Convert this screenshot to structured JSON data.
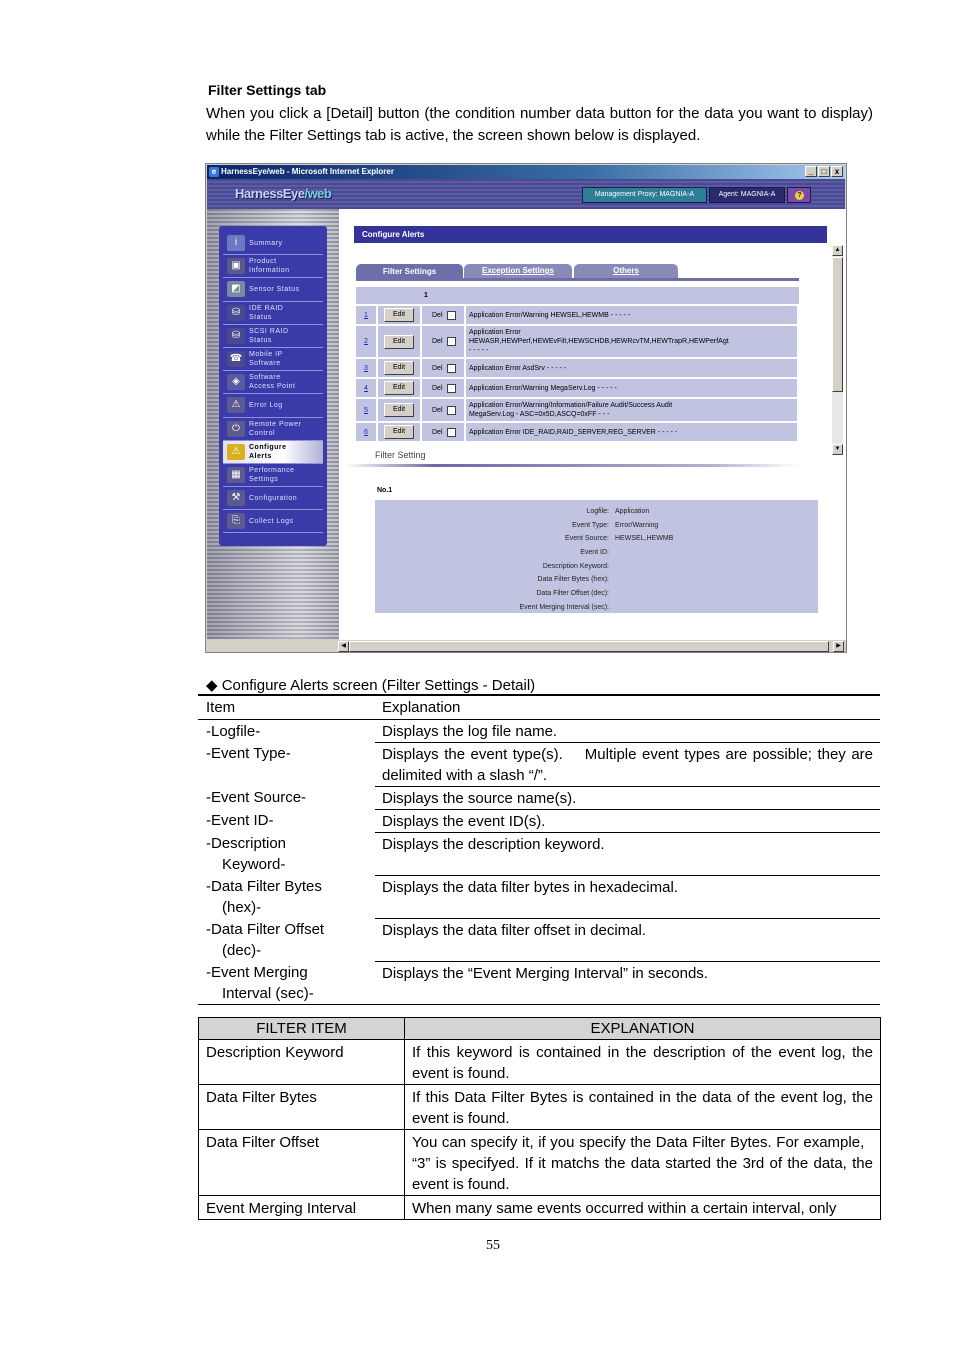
{
  "doc": {
    "section_title": "Filter Settings tab",
    "intro": "When you click a [Detail] button (the condition number data button for the data you want to display) while the Filter Settings tab is active, the screen shown below is displayed.",
    "caption": "◆ Configure Alerts screen (Filter Settings - Detail)",
    "page_number": "55"
  },
  "browser": {
    "title": "HarnessEye/web - Microsoft Internet Explorer",
    "window_buttons": [
      "_",
      "□",
      "x"
    ],
    "logo_main": "HarnessEye",
    "logo_suffix": "/web",
    "management_proxy": "Management Proxy: MAGNIA-A",
    "agent": "Agent: MAGNIA-A",
    "help_glyph": "?",
    "nav": [
      {
        "label1": "Summary",
        "label2": "",
        "icon": "info-icon",
        "glyph": "i",
        "color": "#6a7ac0"
      },
      {
        "label1": "Product",
        "label2": "Information",
        "icon": "product-info-icon",
        "glyph": "▣",
        "color": "#5a5a8a"
      },
      {
        "label1": "Sensor Status",
        "label2": "",
        "icon": "sensor-icon",
        "glyph": "◩",
        "color": "#7a8aa0"
      },
      {
        "label1": "IDE RAID",
        "label2": "Status",
        "icon": "ide-raid-icon",
        "glyph": "⛁",
        "color": "#4a4a90"
      },
      {
        "label1": "SCSI RAID",
        "label2": "Status",
        "icon": "scsi-raid-icon",
        "glyph": "⛁",
        "color": "#4a4a90"
      },
      {
        "label1": "Mobile IP",
        "label2": "Software",
        "icon": "mobile-ip-icon",
        "glyph": "☎",
        "color": "#4a4a90"
      },
      {
        "label1": "Software",
        "label2": "Access Point",
        "icon": "access-point-icon",
        "glyph": "◈",
        "color": "#5a5aa0"
      },
      {
        "label1": "Error Log",
        "label2": "",
        "icon": "warning-icon",
        "glyph": "⚠",
        "color": "#5a5a90"
      },
      {
        "label1": "Remote Power",
        "label2": "Control",
        "icon": "remote-power-icon",
        "glyph": "⏻",
        "color": "#5a5a90"
      },
      {
        "label1": "Configure",
        "label2": "Alerts",
        "icon": "configure-alerts-icon",
        "glyph": "⚠",
        "color": "#d8b020",
        "active": true
      },
      {
        "label1": "Performance",
        "label2": "Settings",
        "icon": "performance-icon",
        "glyph": "▦",
        "color": "#5a5a90"
      },
      {
        "label1": "Configuration",
        "label2": "",
        "icon": "configuration-icon",
        "glyph": "⚒",
        "color": "#5a5a90"
      },
      {
        "label1": "Collect Logs",
        "label2": "",
        "icon": "collect-logs-icon",
        "glyph": "⎘",
        "color": "#5a5a90"
      }
    ],
    "page_heading": "Configure Alerts",
    "tabs": [
      "Filter Settings",
      "Exception Settings",
      "Others"
    ],
    "page_indicator": "1",
    "edit_label": "Edit",
    "del_label": "Del",
    "conditions": [
      {
        "num": "1",
        "desc1": "Application Error/Warning HEWSEL,HEWMB - - - - -",
        "desc2": "",
        "desc3": ""
      },
      {
        "num": "2",
        "desc1": "Application Error",
        "desc2": "HEWASR,HEWPerf,HEWEvFilt,HEWSCHDB,HEWRcvTM,HEWTrapR,HEWPerfAgt",
        "desc3": "- - - - -"
      },
      {
        "num": "3",
        "desc1": "Application Error AsdSrv - - - - -",
        "desc2": "",
        "desc3": ""
      },
      {
        "num": "4",
        "desc1": "Application Error/Warning MegaServ.Log - - - - -",
        "desc2": "",
        "desc3": ""
      },
      {
        "num": "5",
        "desc1": "Application Error/Warning/Information/Failure Audit/Success Audit",
        "desc2": "MegaServ.Log - ASC=0x5D,ASCQ=0xFF - - -",
        "desc3": ""
      },
      {
        "num": "6",
        "desc1": "Application Error IDE_RAID,RAID_SERVER,REG_SERVER - - - - -",
        "desc2": "",
        "desc3": ""
      }
    ],
    "filter_setting_label": "Filter Setting",
    "detail_title": "No.1",
    "detail": [
      {
        "label": "Logfile:",
        "value": "Application"
      },
      {
        "label": "Event Type:",
        "value": "Error/Warning"
      },
      {
        "label": "Event Source:",
        "value": "HEWSEL,HEWMB"
      },
      {
        "label": "Event ID:",
        "value": ""
      },
      {
        "label": "Description Keyword:",
        "value": ""
      },
      {
        "label": "Data Filter Bytes (hex):",
        "value": ""
      },
      {
        "label": "Data Filter Offset (dec):",
        "value": ""
      },
      {
        "label": "Event Merging Interval (sec):",
        "value": ""
      }
    ]
  },
  "item_table": {
    "headers": [
      "Item",
      "Explanation"
    ],
    "rows": [
      {
        "item1": "-Logfile-",
        "item2": "",
        "expl": "Displays the log file name."
      },
      {
        "item1": "-Event Type-",
        "item2": "",
        "expl": "Displays the event type(s).    Multiple event types are possible; they are delimited with a slash “/”."
      },
      {
        "item1": "-Event Source-",
        "item2": "",
        "expl": "Displays the source name(s)."
      },
      {
        "item1": "-Event ID-",
        "item2": "",
        "expl": "Displays the event ID(s)."
      },
      {
        "item1": "-Description",
        "item2": "Keyword-",
        "expl": "Displays the description keyword."
      },
      {
        "item1": "-Data Filter Bytes",
        "item2": "(hex)-",
        "expl": "Displays the data filter bytes in hexadecimal."
      },
      {
        "item1": "-Data Filter Offset",
        "item2": "(dec)-",
        "expl": "Displays the data filter offset in decimal."
      },
      {
        "item1": "-Event Merging",
        "item2": "Interval (sec)-",
        "expl": "Displays the “Event Merging Interval” in seconds."
      }
    ]
  },
  "filter_table": {
    "headers": [
      "FILTER ITEM",
      "EXPLANATION"
    ],
    "rows": [
      {
        "item": "Description Keyword",
        "expl": "If this keyword is contained in the description of the event log, the event is found."
      },
      {
        "item": "Data Filter Bytes",
        "expl": "If this Data Filter Bytes is contained in the data of the event log, the event is found."
      },
      {
        "item": "Data Filter Offset",
        "expl": "You can specify it, if you specify the Data Filter Bytes. For example,   “3” is specifyed. If it matchs the data started the 3rd of the data, the event is found."
      },
      {
        "item": "Event Merging Interval",
        "expl": "When many same events occurred within a certain interval, only"
      }
    ]
  }
}
